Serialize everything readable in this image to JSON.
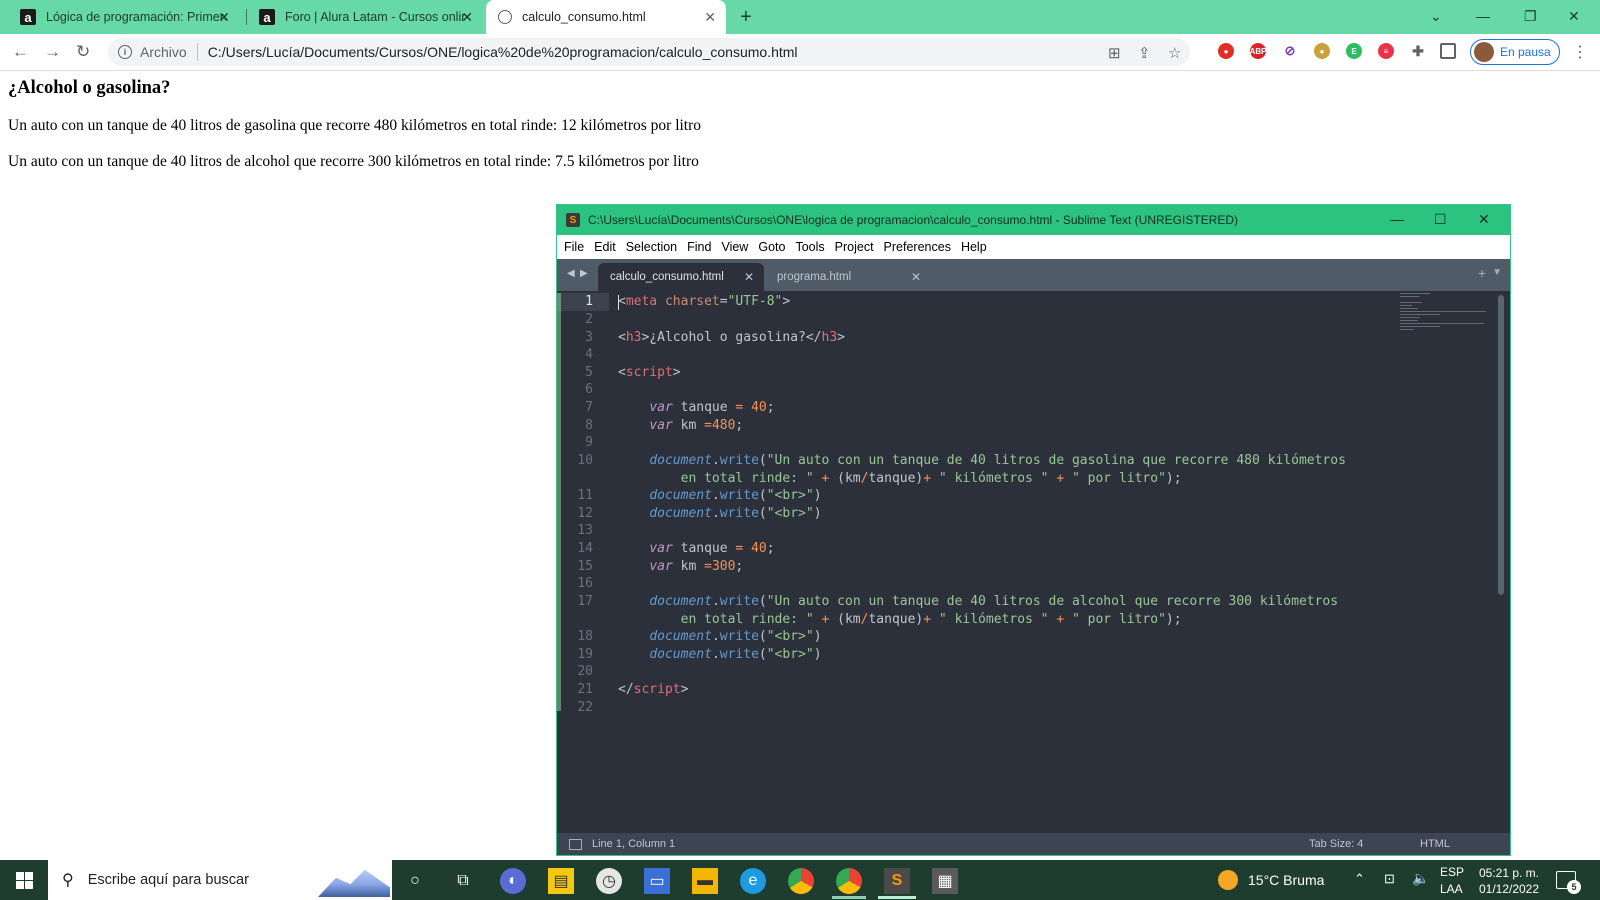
{
  "browser": {
    "tabs": [
      {
        "title": "Lógica de programación: Primeros",
        "favicon": "alura-icon"
      },
      {
        "title": "Foro | Alura Latam - Cursos online",
        "favicon": "alura-icon"
      },
      {
        "title": "calculo_consumo.html",
        "favicon": "globe-icon"
      }
    ],
    "scheme_label": "Archivo",
    "url": "C:/Users/Lucía/Documents/Cursos/ONE/logica%20de%20programacion/calculo_consumo.html",
    "profile_label": "En pausa",
    "accent_color": "#66d9a6"
  },
  "page": {
    "heading": "¿Alcohol o gasolina?",
    "line1": "Un auto con un tanque de 40 litros de gasolina que recorre 480 kilómetros en total rinde: 12 kilómetros por litro",
    "line2": "Un auto con un tanque de 40 litros de alcohol que recorre 300 kilómetros en total rinde: 7.5 kilómetros por litro"
  },
  "sublime": {
    "title": "C:\\Users\\Lucía\\Documents\\Cursos\\ONE\\logica de programacion\\calculo_consumo.html - Sublime Text (UNREGISTERED)",
    "menu": [
      "File",
      "Edit",
      "Selection",
      "Find",
      "View",
      "Goto",
      "Tools",
      "Project",
      "Preferences",
      "Help"
    ],
    "tabs": [
      "calculo_consumo.html",
      "programa.html"
    ],
    "line_numbers": [
      "1",
      "2",
      "3",
      "4",
      "5",
      "6",
      "7",
      "8",
      "9",
      "10",
      "",
      "11",
      "12",
      "13",
      "14",
      "15",
      "16",
      "17",
      "",
      "18",
      "19",
      "20",
      "21",
      "22"
    ],
    "status": {
      "position": "Line 1, Column 1",
      "tab_size": "Tab Size: 4",
      "syntax": "HTML"
    }
  },
  "taskbar": {
    "search_placeholder": "Escribe aquí para buscar",
    "weather": "15°C  Bruma",
    "lang_top": "ESP",
    "lang_bottom": "LAA",
    "time": "05:21 p. m.",
    "date": "01/12/2022",
    "notification_count": "5"
  }
}
